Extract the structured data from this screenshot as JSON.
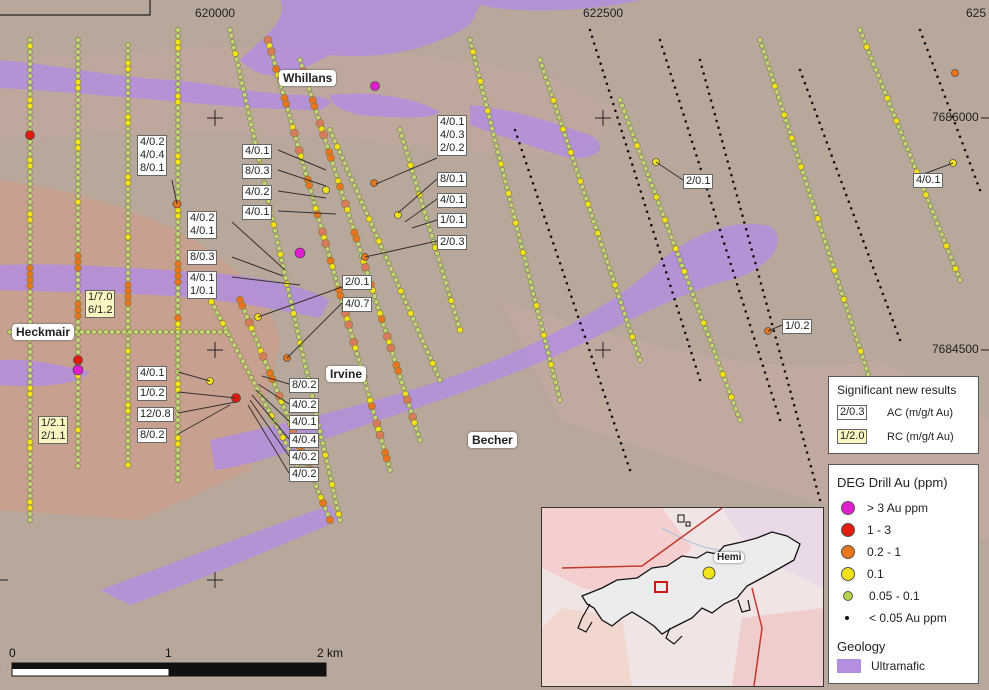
{
  "coords": {
    "easting": [
      "620000",
      "622500",
      "625"
    ],
    "northing": [
      "7686000",
      "7684500"
    ]
  },
  "places": [
    "Whillans",
    "Heckmair",
    "Irvine",
    "Becher",
    "Hemi"
  ],
  "callouts": {
    "a1": "4/0.2\n4/0.4\n8/0.1",
    "a2": "4/0.1",
    "a3": "8/0.3",
    "a4": "4/0.2",
    "a5": "4/0.1",
    "a6": "4/0.2\n4/0.1",
    "a7": "8/0.3",
    "a8": "4/0.1\n1/0.1",
    "a9": "4/0.1\n4/0.3\n2/0.2",
    "a10": "8/0.1",
    "a11": "4/0.1",
    "a12": "1/0.1",
    "a13": "2/0.3",
    "a14": "2/0.1",
    "a15": "4/0.7",
    "a16": "2/0.1",
    "a17": "4/0.1",
    "a18": "1/0.2",
    "a19": "4/0.1",
    "a20": "1/0.2",
    "a21": "12/0.8",
    "a22": "8/0.2",
    "a23": "8/0.2",
    "a24": "4/0.2",
    "a25": "4/0.1",
    "a26": "4/0.4",
    "a27": "4/0.2",
    "a28": "4/0.2",
    "r1": "1/7.0\n6/1.2",
    "r2": "1/2.1\n2/1.1"
  },
  "results_legend": {
    "title": "Significant new results",
    "ac_sample": "2/0.3",
    "ac_text": "AC (m/g/t Au)",
    "rc_sample": "1/2.0",
    "rc_text": "RC (m/g/t Au)"
  },
  "drill_legend": {
    "title": "DEG Drill Au (ppm)",
    "items": [
      {
        "label": "> 3 Au ppm",
        "color": "#e020d0"
      },
      {
        "label": "1 - 3",
        "color": "#e01b10"
      },
      {
        "label": "0.2 - 1",
        "color": "#e8751e"
      },
      {
        "label": "0.1",
        "color": "#f2e21a"
      },
      {
        "label": "0.05 - 0.1",
        "color": "#b8d24a"
      },
      {
        "label": "< 0.05 Au ppm",
        "color": "#111111"
      }
    ],
    "geology_title": "Geology",
    "ultramafic_label": "Ultramafic",
    "ultramafic_color": "#b48ee0"
  },
  "scale": {
    "labels": [
      "0",
      "1",
      "2 km"
    ]
  },
  "colors": {
    "background": "#b9a89a",
    "ultramafic": "#b48ee0",
    "anomaly": "#e87e6a"
  }
}
